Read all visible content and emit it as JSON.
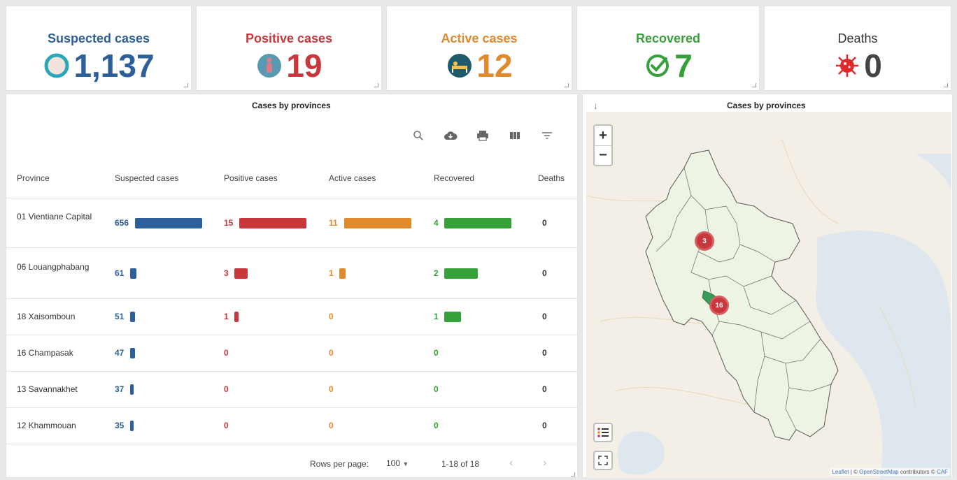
{
  "kpis": [
    {
      "title": "Suspected cases",
      "value": "1,137",
      "color": "#2d5f9a",
      "icon": "circle-icon"
    },
    {
      "title": "Positive cases",
      "value": "19",
      "color": "#c8373c",
      "icon": "person-icon"
    },
    {
      "title": "Active cases",
      "value": "12",
      "color": "#e08a2c",
      "icon": "hospital-bed-icon"
    },
    {
      "title": "Recovered",
      "value": "7",
      "color": "#36a13a",
      "icon": "check-circle-icon"
    },
    {
      "title": "Deaths",
      "value": "0",
      "color": "#444444",
      "icon": "virus-icon"
    }
  ],
  "table": {
    "title": "Cases by provinces",
    "toolbar": [
      "search-icon",
      "cloud-download-icon",
      "print-icon",
      "view-columns-icon",
      "filter-icon"
    ],
    "columns": [
      "Province",
      "Suspected cases",
      "Positive cases",
      "Active cases",
      "Recovered",
      "Deaths"
    ],
    "rows": [
      {
        "province": "01 Vientiane Capital",
        "suspected": "656",
        "positive": "15",
        "active": "11",
        "recovered": "4",
        "deaths": "0"
      },
      {
        "province": "06 Louangphabang",
        "suspected": "61",
        "positive": "3",
        "active": "1",
        "recovered": "2",
        "deaths": "0"
      },
      {
        "province": "18 Xaisomboun",
        "suspected": "51",
        "positive": "1",
        "active": "0",
        "recovered": "1",
        "deaths": "0"
      },
      {
        "province": "16 Champasak",
        "suspected": "47",
        "positive": "0",
        "active": "0",
        "recovered": "0",
        "deaths": "0"
      },
      {
        "province": "13 Savannakhet",
        "suspected": "37",
        "positive": "0",
        "active": "0",
        "recovered": "0",
        "deaths": "0"
      },
      {
        "province": "12 Khammouan",
        "suspected": "35",
        "positive": "0",
        "active": "0",
        "recovered": "0",
        "deaths": "0"
      }
    ],
    "footer": {
      "rows_per_page_label": "Rows per page:",
      "rows_per_page": "100",
      "range": "1-18 of 18"
    }
  },
  "map": {
    "title": "Cases by provinces",
    "zoom_in": "+",
    "zoom_out": "−",
    "clusters": [
      "3",
      "16"
    ],
    "attribution": {
      "leaflet": "Leaflet",
      "sep": " | © ",
      "osm": "OpenStreetMap",
      "contrib": " contributors © ",
      "carto": "CAF"
    }
  },
  "colors": {
    "suspected": "#2d5f9a",
    "positive": "#c8373c",
    "active": "#e08a2c",
    "recovered": "#36a13a"
  }
}
